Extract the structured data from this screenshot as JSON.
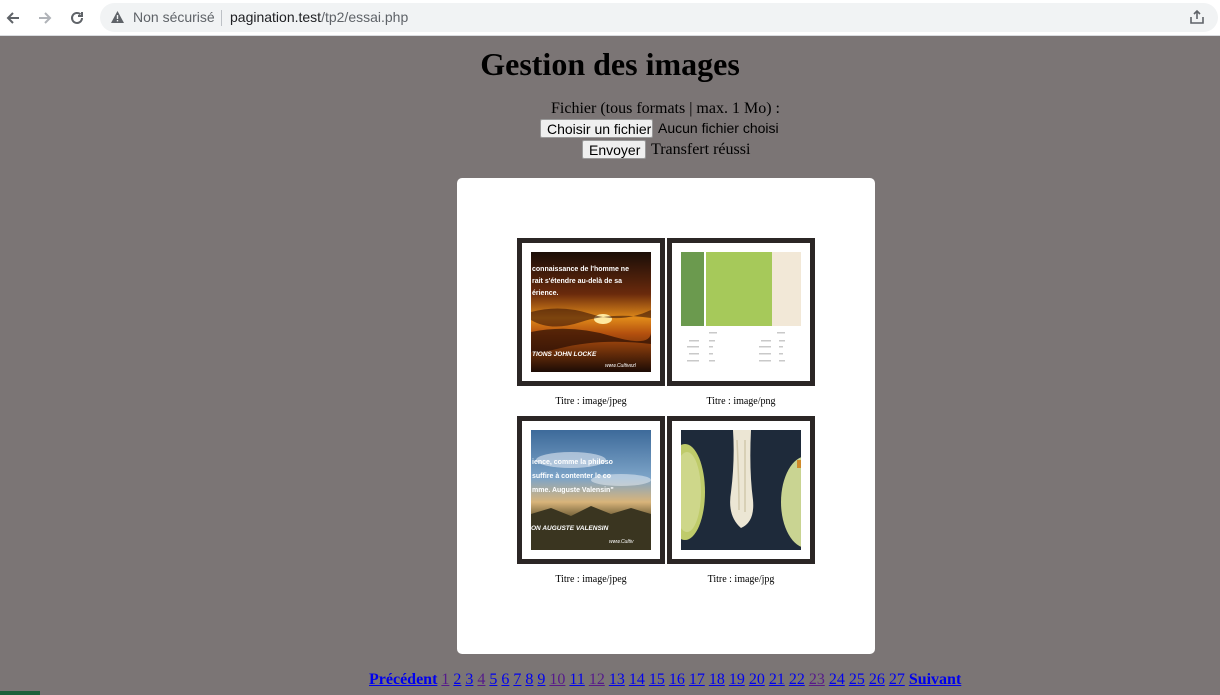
{
  "browser": {
    "security_label": "Non sécurisé",
    "url_host": "pagination.test",
    "url_path": "/tp2/essai.php"
  },
  "page": {
    "title": "Gestion des images",
    "file_label": "Fichier (tous formats | max. 1 Mo) :",
    "choose_button": "Choisir un fichier",
    "no_file": "Aucun fichier choisi",
    "send_button": "Envoyer",
    "status": "Transfert réussi"
  },
  "gallery": [
    {
      "caption": "Titre : image/jpeg",
      "kind": "sunset-quote-photo",
      "overlay_lines": [
        "connaissance de l'homme ne",
        "rait s'étendre au-delà de sa",
        "érience."
      ],
      "credit": "TIONS JOHN LOCKE",
      "site": "www.Cultivezl"
    },
    {
      "caption": "Titre : image/png",
      "kind": "color-palette"
    },
    {
      "caption": "Titre : image/jpeg",
      "kind": "sky-quote-photo",
      "overlay_lines": [
        "ience, comme la philoso",
        "suffire à contenter le co",
        "mme. Auguste Valensin\""
      ],
      "credit": "ON AUGUSTE VALENSIN",
      "site": "www.Cultiv"
    },
    {
      "caption": "Titre : image/jpg",
      "kind": "breadfruit-photo"
    }
  ],
  "pagination": {
    "prev": "Précédent",
    "next": "Suivant",
    "pages": [
      "1",
      "2",
      "3",
      "4",
      "5",
      "6",
      "7",
      "8",
      "9",
      "10",
      "11",
      "12",
      "13",
      "14",
      "15",
      "16",
      "17",
      "18",
      "19",
      "20",
      "21",
      "22",
      "23",
      "24",
      "25",
      "26",
      "27"
    ],
    "visited": [
      "1",
      "4",
      "10",
      "12",
      "23"
    ]
  },
  "colors": {
    "page_background": "#7b7575",
    "frame": "#2b2625",
    "link": "#0000ee",
    "visited_link": "#551a8b"
  }
}
